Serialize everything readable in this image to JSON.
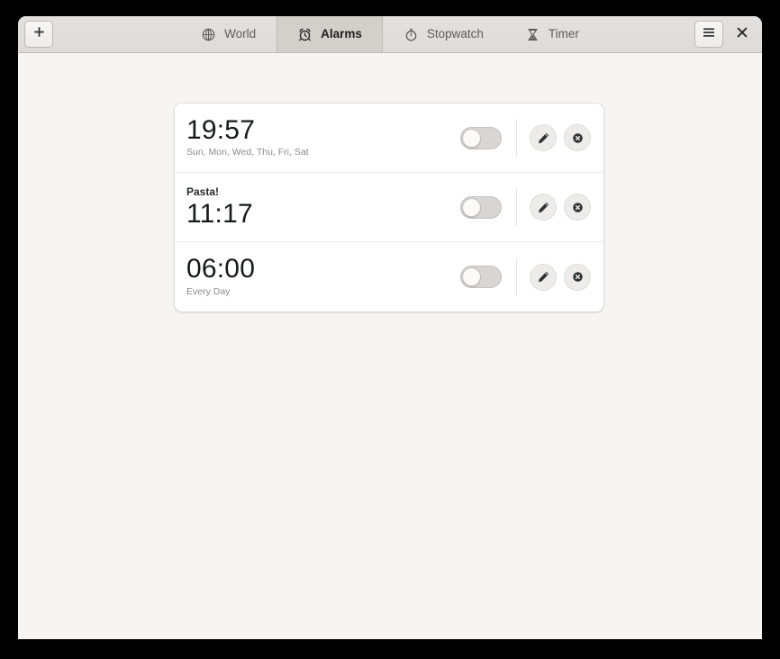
{
  "window": {
    "add_button_label": "+",
    "add_button_icon": "plus-icon",
    "menu_button_icon": "hamburger-menu-icon",
    "close_button_icon": "close-icon"
  },
  "tabs": [
    {
      "id": "world",
      "label": "World",
      "icon": "globe-icon",
      "active": false
    },
    {
      "id": "alarms",
      "label": "Alarms",
      "icon": "alarm-clock-icon",
      "active": true
    },
    {
      "id": "stopwatch",
      "label": "Stopwatch",
      "icon": "stopwatch-icon",
      "active": false
    },
    {
      "id": "timer",
      "label": "Timer",
      "icon": "hourglass-icon",
      "active": false
    }
  ],
  "alarms": [
    {
      "title": "",
      "time": "19:57",
      "days": "Sun, Mon, Wed, Thu, Fri, Sat",
      "enabled": false,
      "edit_icon": "pencil-icon",
      "delete_icon": "delete-circle-icon"
    },
    {
      "title": "Pasta!",
      "time": "11:17",
      "days": "",
      "enabled": false,
      "edit_icon": "pencil-icon",
      "delete_icon": "delete-circle-icon"
    },
    {
      "title": "",
      "time": "06:00",
      "days": "Every Day",
      "enabled": false,
      "edit_icon": "pencil-icon",
      "delete_icon": "delete-circle-icon"
    }
  ],
  "colors": {
    "headerbar": "#dedbd8",
    "active_tab": "#d3d0cc",
    "content_background": "#f6f5f4",
    "card_background": "#ffffff",
    "toggle_off": "#d8d5d2",
    "time_text": "#17191a",
    "days_text": "#8b8b8b"
  }
}
